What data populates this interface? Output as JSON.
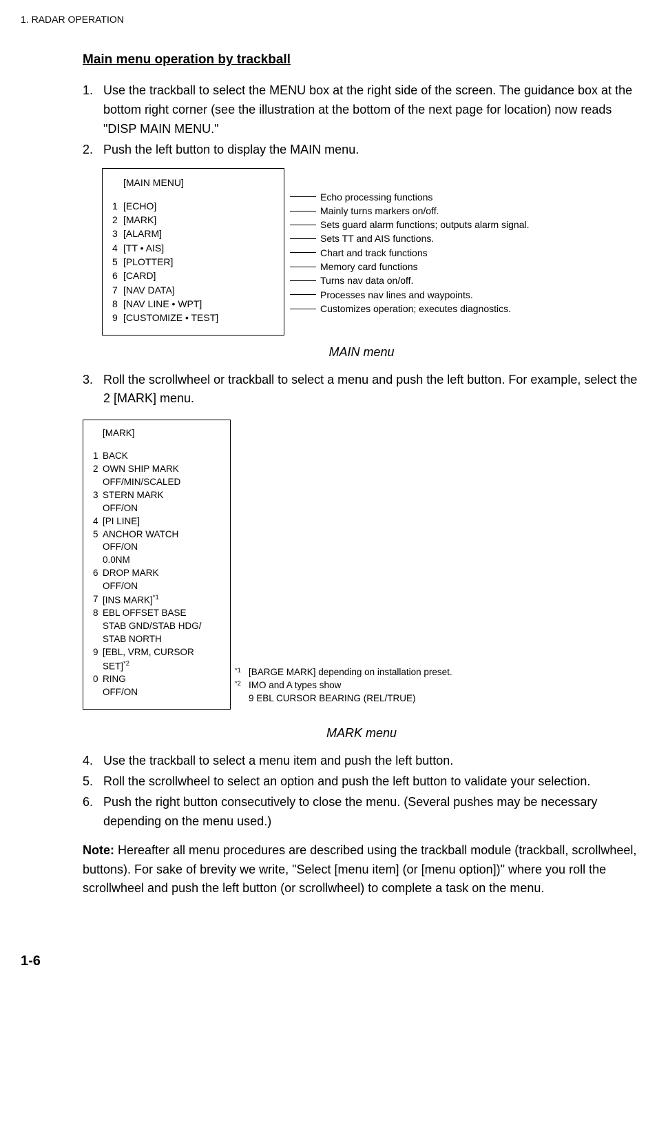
{
  "header": "1. RADAR OPERATION",
  "section_title": "Main menu operation by trackball",
  "steps": {
    "s1": {
      "n": "1.",
      "t": "Use the trackball to select the MENU box at the right side of the screen. The guidance box at the bottom right corner (see the illustration at the bottom of the next page for location) now reads \"DISP MAIN MENU.\""
    },
    "s2": {
      "n": "2.",
      "t": "Push the left button to display the MAIN menu."
    },
    "s3": {
      "n": "3.",
      "t": "Roll the scrollwheel or trackball to select a menu and push the left button. For example, select the 2 [MARK] menu."
    },
    "s4": {
      "n": "4.",
      "t": "Use the trackball to select a menu item and push the left button."
    },
    "s5": {
      "n": "5.",
      "t": "Roll the scrollwheel to select an option and push the left button to validate your selection."
    },
    "s6": {
      "n": "6.",
      "t": "Push the right button consecutively to close the menu. (Several pushes may be necessary depending on the menu used.)"
    }
  },
  "main_menu": {
    "title": "[MAIN MENU]",
    "items": [
      {
        "n": "1",
        "l": "[ECHO]",
        "d": "Echo processing functions"
      },
      {
        "n": "2",
        "l": "[MARK]",
        "d": "Mainly turns markers on/off."
      },
      {
        "n": "3",
        "l": "[ALARM]",
        "d": "Sets guard alarm functions; outputs alarm signal."
      },
      {
        "n": "4",
        "l": "[TT • AIS]",
        "d": "Sets TT and AIS functions."
      },
      {
        "n": "5",
        "l": "[PLOTTER]",
        "d": "Chart and track functions"
      },
      {
        "n": "6",
        "l": "[CARD]",
        "d": "Memory card functions"
      },
      {
        "n": "7",
        "l": "[NAV DATA]",
        "d": "Turns nav data on/off."
      },
      {
        "n": "8",
        "l": "[NAV LINE • WPT]",
        "d": "Processes nav lines and waypoints."
      },
      {
        "n": "9",
        "l": "[CUSTOMIZE • TEST]",
        "d": "Customizes operation; executes diagnostics."
      }
    ]
  },
  "caption1": "MAIN menu",
  "mark_menu": {
    "title": "[MARK]",
    "r1n": "1",
    "r1": "BACK",
    "r2n": "2",
    "r2": "OWN SHIP MARK",
    "r2s": "OFF/MIN/SCALED",
    "r3n": "3",
    "r3": "STERN MARK",
    "r3s": "OFF/ON",
    "r4n": "4",
    "r4": "[PI LINE]",
    "r5n": "5",
    "r5": "ANCHOR  WATCH",
    "r5s1": "OFF/ON",
    "r5s2": "0.0NM",
    "r6n": "6",
    "r6": "DROP MARK",
    "r6s": "OFF/ON",
    "r7n": "7",
    "r7a": "[INS MARK]",
    "r7sup": "*1",
    "r8n": "8",
    "r8": "EBL OFFSET BASE",
    "r8s1": "STAB GND/STAB HDG/",
    "r8s2": "STAB NORTH",
    "r9n": "9",
    "r9a": "[EBL, VRM, CURSOR SET]",
    "r9sup": "*2",
    "r0n": "0",
    "r0": "RING",
    "r0s": "OFF/ON"
  },
  "footnotes": {
    "f1sym": "*1",
    "f1": "[BARGE MARK] depending on installation preset.",
    "f2sym": "*2",
    "f2a": "IMO and A types show",
    "f2b": "9 EBL CURSOR BEARING (REL/TRUE)"
  },
  "caption2": "MARK menu",
  "note_label": "Note:",
  "note_text": " Hereafter all menu procedures are described using the trackball module (trackball, scrollwheel, buttons). For sake of brevity we write, \"Select [menu item] (or [menu option])\" where you roll the scrollwheel and push the left button (or scrollwheel) to complete a task on the menu.",
  "page_number": "1-6"
}
